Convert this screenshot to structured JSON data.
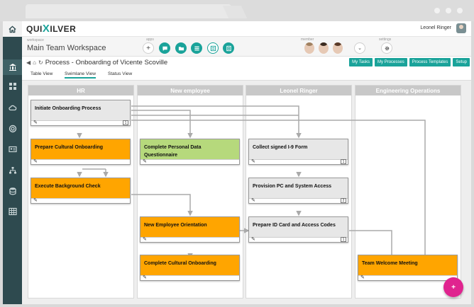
{
  "app": {
    "logo_pre": "QUI",
    "logo_x": "X",
    "logo_post": "ILVER",
    "user_name": "Leonel Ringer",
    "accent_color": "#1aa39a",
    "sidebar_color": "#2e4a4f"
  },
  "sidebar": {
    "home_icon": "home-icon",
    "items": [
      {
        "icon": "bank-icon",
        "active": true
      },
      {
        "icon": "grid-icon",
        "active": false
      },
      {
        "icon": "cloud-icon",
        "active": false
      },
      {
        "icon": "lifebuoy-icon",
        "active": false
      },
      {
        "icon": "id-card-icon",
        "active": false
      },
      {
        "icon": "org-chart-icon",
        "active": false
      },
      {
        "icon": "database-icon",
        "active": false
      },
      {
        "icon": "table-icon",
        "active": false
      }
    ]
  },
  "workspace": {
    "label": "workspace",
    "name": "Main Team Workspace",
    "apps_label": "apps",
    "member_label": "member",
    "settings_label": "settings",
    "apps": [
      "add-icon",
      "chat-icon",
      "folder-icon",
      "list-icon",
      "news-icon",
      "form-icon"
    ],
    "members": [
      "member-avatar-1",
      "member-avatar-2",
      "member-avatar-3"
    ]
  },
  "header": {
    "title": "Process - Onboarding of Vicente Scoville",
    "actions": [
      "My Tasks",
      "My Processes",
      "Process Templates",
      "Setup"
    ]
  },
  "views": {
    "tabs": [
      "Table View",
      "Swimlane View",
      "Status View"
    ],
    "active": "Swimlane View"
  },
  "lanes": [
    {
      "title": "HR",
      "cards": [
        {
          "title": "Initiate Onboarding Process",
          "color": "gray",
          "count": "1"
        },
        {
          "title": "Prepare Cultural Onboarding",
          "color": "orange",
          "count": ""
        },
        {
          "title": "Execute Background Check",
          "color": "orange",
          "count": ""
        }
      ]
    },
    {
      "title": "New employee",
      "cards": [
        {
          "title": "Complete Personal Data Questionnaire",
          "color": "green",
          "count": ""
        },
        {
          "title": "New Employee Orientation",
          "color": "orange",
          "count": ""
        },
        {
          "title": "Complete Cultural Onboarding",
          "color": "orange",
          "count": ""
        }
      ]
    },
    {
      "title": "Leonel Ringer",
      "cards": [
        {
          "title": "Collect signed I-9 Form",
          "color": "gray",
          "count": "1"
        },
        {
          "title": "Provision PC and System Access",
          "color": "gray",
          "count": "2"
        },
        {
          "title": "Prepare ID Card and Access Codes",
          "color": "gray",
          "count": "1"
        }
      ]
    },
    {
      "title": "Engineering Operations",
      "cards": [
        {
          "title": "Team Welcome Meeting",
          "color": "orange",
          "count": ""
        }
      ]
    }
  ],
  "fab_label": "+"
}
